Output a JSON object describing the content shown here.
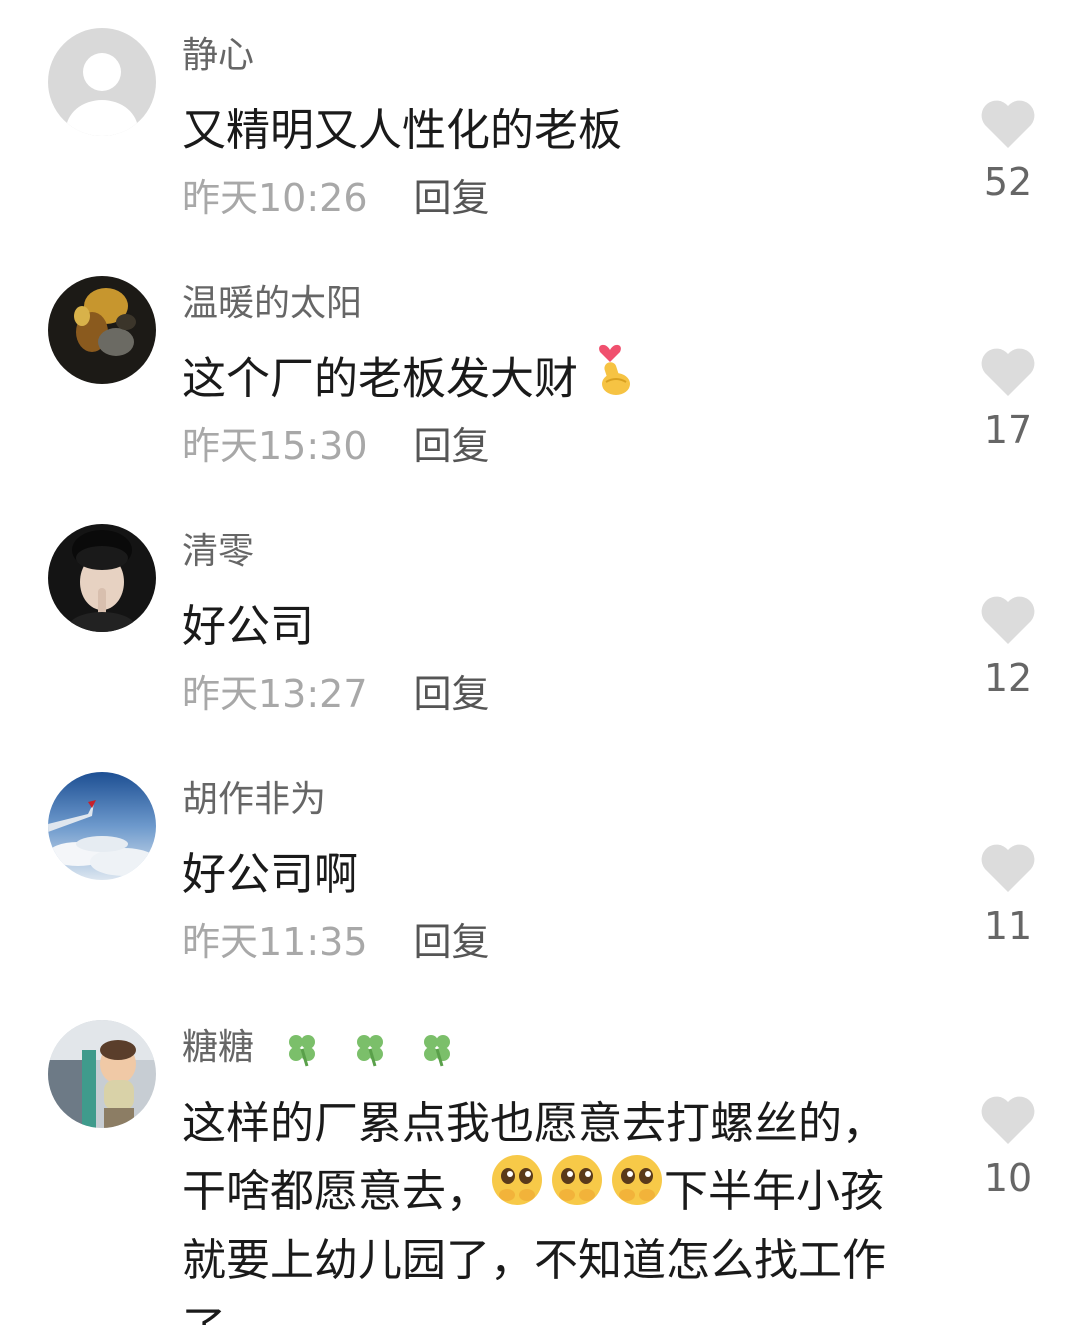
{
  "comments": [
    {
      "username": "静心",
      "text": "又精明又人性化的老板",
      "time": "昨天10:26",
      "reply_label": "回复",
      "likes": "52",
      "avatar": "default-avatar-icon"
    },
    {
      "username": "温暖的太阳",
      "text": "这个厂的老板发大财",
      "time": "昨天15:30",
      "reply_label": "回复",
      "likes": "17",
      "avatar": "user-photo",
      "emoji": "finger-heart-emoji"
    },
    {
      "username": "清零",
      "text": "好公司",
      "time": "昨天13:27",
      "reply_label": "回复",
      "likes": "12",
      "avatar": "user-photo"
    },
    {
      "username": "胡作非为",
      "text": "好公司啊",
      "time": "昨天11:35",
      "reply_label": "回复",
      "likes": "11",
      "avatar": "user-photo"
    },
    {
      "username": "糖糖",
      "username_emoji": "four-leaf-clover-emoji",
      "text_part1": "这样的厂累点我也愿意去打螺丝的，干啥都愿意去，",
      "text_part2": "下半年小孩就要上幼儿园了，不知道怎么找工作了",
      "likes": "10",
      "avatar": "user-photo",
      "emoji": "pleading-face-emoji"
    }
  ],
  "colors": {
    "heart": "#dcdcdc",
    "time": "#a8a8a8",
    "username": "#666666",
    "text": "#1a1a1a"
  }
}
